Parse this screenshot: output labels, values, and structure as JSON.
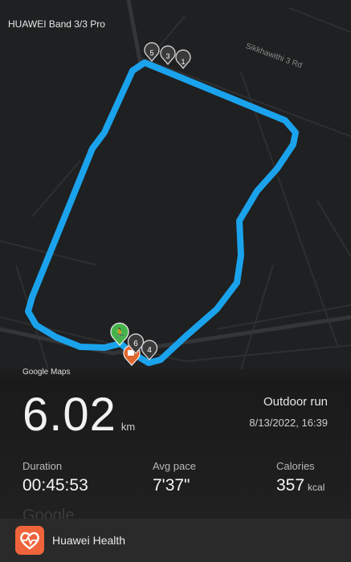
{
  "device_name": "HUAWEI Band 3/3 Pro",
  "street_label": "Sikkhawithi 3 Rd",
  "map_attribution": "Google Maps",
  "watermark": "Google",
  "route_color": "#1aa3ec",
  "km_markers": [
    "1",
    "3",
    "4",
    "5",
    "6"
  ],
  "start_icon": "runner-icon",
  "summary": {
    "distance_value": "6.02",
    "distance_unit": "km",
    "activity_type": "Outdoor run",
    "datetime": "8/13/2022, 16:39",
    "duration_label": "Duration",
    "duration_value": "00:45:53",
    "pace_label": "Avg pace",
    "pace_value": "7'37\"",
    "calories_label": "Calories",
    "calories_value": "357",
    "calories_unit": "kcal"
  },
  "app_bar": {
    "app_name": "Huawei Health",
    "icon": "heart-icon",
    "accent": "#f0643c"
  }
}
